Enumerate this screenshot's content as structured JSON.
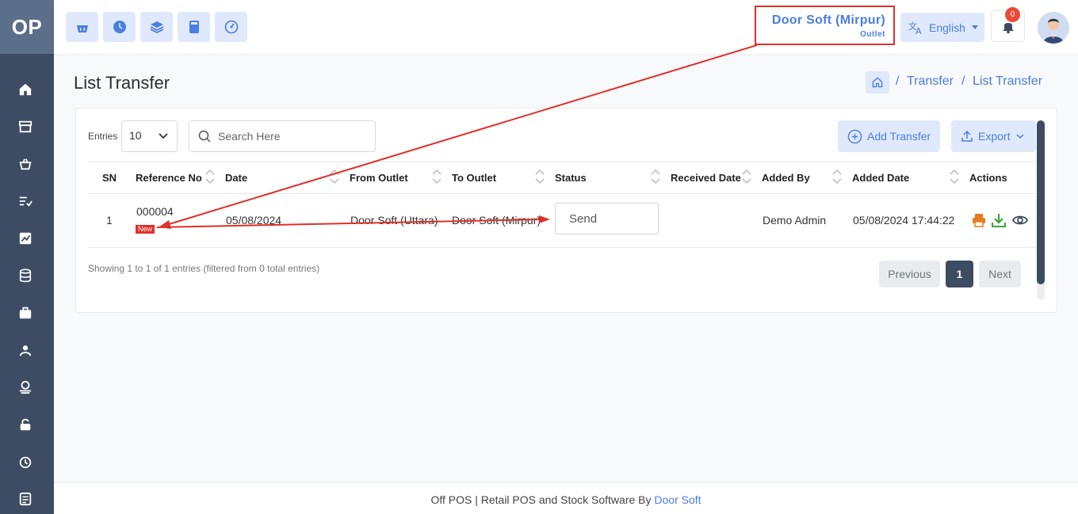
{
  "app": {
    "logo_text": "OP"
  },
  "sidebar": {
    "items": [
      {
        "icon": "home-icon"
      },
      {
        "icon": "store-icon"
      },
      {
        "icon": "basket-icon"
      },
      {
        "icon": "list-icon"
      },
      {
        "icon": "chart-icon"
      },
      {
        "icon": "database-icon"
      },
      {
        "icon": "bag-icon"
      },
      {
        "icon": "user-settings-icon"
      },
      {
        "icon": "money-icon"
      },
      {
        "icon": "lock-icon"
      },
      {
        "icon": "clock-icon"
      },
      {
        "icon": "note-icon"
      }
    ]
  },
  "header": {
    "quick_buttons": [
      "basket-icon",
      "clock-icon",
      "layers-icon",
      "calculator-icon",
      "dashboard-icon"
    ],
    "outlet_name": "Door Soft (Mirpur)",
    "outlet_label": "Outlet",
    "language": "English",
    "notification_count": "0"
  },
  "page": {
    "title": "List Transfer",
    "breadcrumb": [
      "Transfer",
      "List Transfer"
    ],
    "breadcrumb_sep": "/"
  },
  "toolbar": {
    "entries_label": "Entries",
    "entries_value": "10",
    "search_placeholder": "Search Here",
    "add_label": "Add Transfer",
    "export_label": "Export"
  },
  "table": {
    "columns": [
      "SN",
      "Reference No",
      "Date",
      "From Outlet",
      "To Outlet",
      "Status",
      "Received Date",
      "Added By",
      "Added Date",
      "Actions"
    ],
    "rows": [
      {
        "sn": "1",
        "reference": "000004",
        "new_badge": "New",
        "date": "05/08/2024",
        "from_outlet": "Door Soft (Uttara)",
        "to_outlet": "Door Soft (Mirpur)",
        "status": "Send",
        "received_date": "",
        "added_by": "Demo Admin",
        "added_date": "05/08/2024 17:44:22"
      }
    ]
  },
  "pagination": {
    "info": "Showing 1 to 1 of 1 entries (filtered from 0 total entries)",
    "previous": "Previous",
    "current": "1",
    "next": "Next"
  },
  "footer": {
    "text": "Off POS | Retail POS and Stock Software By ",
    "link": "Door Soft"
  },
  "colors": {
    "sidebar": "#3d4b63",
    "accent": "#4a7ee0",
    "annotation": "#e0302a"
  }
}
